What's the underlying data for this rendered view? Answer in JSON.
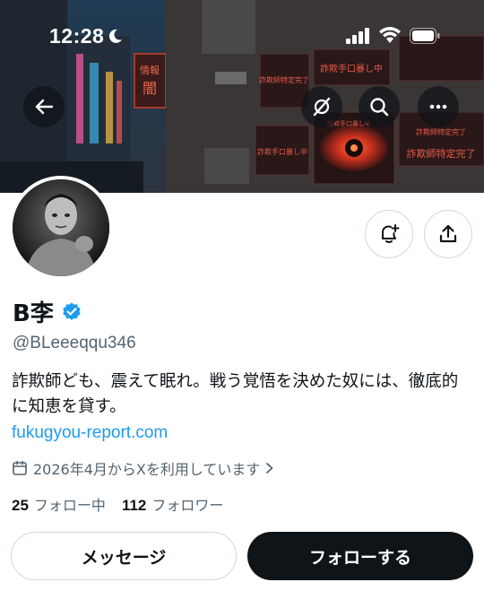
{
  "status_bar": {
    "time": "12:28"
  },
  "banner": {
    "signs": [
      "情報",
      "闇",
      "詐欺師特定完了",
      "詐欺手口暴し中",
      "詐欺手口暴し中",
      "詐欺手口暴し中",
      "詐欺師特定完了",
      "詐欺師特定完了"
    ]
  },
  "header_actions": {
    "back_icon": "arrow-left-icon",
    "grok_icon": "grok-icon",
    "search_icon": "search-icon",
    "more_icon": "more-icon"
  },
  "profile": {
    "display_name": "B李",
    "handle": "@BLeeeqqu346",
    "bio": "詐欺師ども、震えて眠れ。戦う覚悟を決めた奴には、徹底的に知恵を貸す。",
    "link": "fukugyou-report.com",
    "joined": "2026年4月からXを利用しています",
    "following_count": "25",
    "following_label": "フォロー中",
    "followers_count": "112",
    "followers_label": "フォロワー"
  },
  "actions": {
    "message_label": "メッセージ",
    "follow_label": "フォローする",
    "notify_icon": "bell-plus-icon",
    "share_icon": "share-icon"
  },
  "colors": {
    "accent": "#1d9bf0",
    "verified": "#1d9bf0",
    "primary_button": "#0f1419"
  }
}
